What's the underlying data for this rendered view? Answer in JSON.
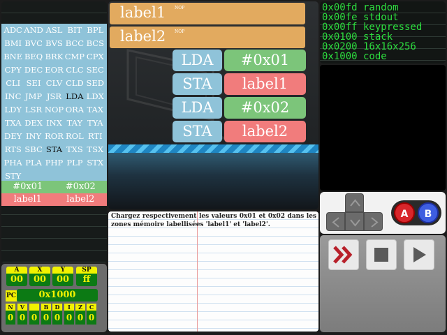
{
  "opcodes": [
    "ADC",
    "AND",
    "ASL",
    "BIT",
    "BPL",
    "BMI",
    "BVC",
    "BVS",
    "BCC",
    "BCS",
    "BNE",
    "BEQ",
    "BRK",
    "CMP",
    "CPX",
    "CPY",
    "DEC",
    "EOR",
    "CLC",
    "SEC",
    "CLI",
    "SEI",
    "CLV",
    "CLD",
    "SED",
    "INC",
    "JMP",
    "JSR",
    "LDA",
    "LDX",
    "LDY",
    "LSR",
    "NOP",
    "ORA",
    "TAX",
    "TXA",
    "DEX",
    "INX",
    "TAY",
    "TYA",
    "DEY",
    "INY",
    "ROR",
    "ROL",
    "RTI",
    "RTS",
    "SBC",
    "STA",
    "TXS",
    "TSX",
    "PHA",
    "PLA",
    "PHP",
    "PLP",
    "STX",
    "STY"
  ],
  "highlighted_opcodes": [
    "LDA",
    "STA"
  ],
  "values": [
    "#0x01",
    "#0x02"
  ],
  "labels": [
    "label1",
    "label2"
  ],
  "registers": [
    {
      "name": "A",
      "value": "00"
    },
    {
      "name": "X",
      "value": "00"
    },
    {
      "name": "Y",
      "value": "00"
    },
    {
      "name": "SP",
      "value": "ff"
    }
  ],
  "pc": {
    "label": "PC",
    "value": "0x1000"
  },
  "flags": [
    {
      "name": "N",
      "value": "0"
    },
    {
      "name": "V",
      "value": "0"
    },
    {
      "name": "",
      "value": "0"
    },
    {
      "name": "B",
      "value": "0"
    },
    {
      "name": "D",
      "value": "0"
    },
    {
      "name": "I",
      "value": "0"
    },
    {
      "name": "Z",
      "value": "0"
    },
    {
      "name": "C",
      "value": "0"
    }
  ],
  "code": {
    "label_lines": [
      {
        "label": "label1",
        "tag": "NOP"
      },
      {
        "label": "label2",
        "tag": "NOP"
      }
    ],
    "instructions": [
      {
        "op": "LDA",
        "arg": "#0x01"
      },
      {
        "op": "STA",
        "arg": "label1"
      },
      {
        "op": "LDA",
        "arg": "#0x02"
      },
      {
        "op": "STA",
        "arg": "label2"
      }
    ]
  },
  "instruction_text": "Chargez respectivement les valeurs 0x01 et 0x02 dans les zones mémoire labellisées 'label1' et 'label2'.",
  "memory_map": [
    "0x00fd random",
    "0x00fe stdout",
    "0x00ff keypressed",
    "0x0100 stack",
    "0x0200 16x16x256",
    "0x1000 code"
  ],
  "gamepad": {
    "a_label": "A",
    "b_label": "B"
  },
  "colors": {
    "opcode_bg": "#8fc3d9",
    "value_bg": "#7cc57a",
    "label_bg": "#f17c7c",
    "label_bar": "#e2aa5f",
    "register_label": "#f2f200",
    "register_value": "#0c7a14",
    "memory_text": "#2dde3f"
  }
}
